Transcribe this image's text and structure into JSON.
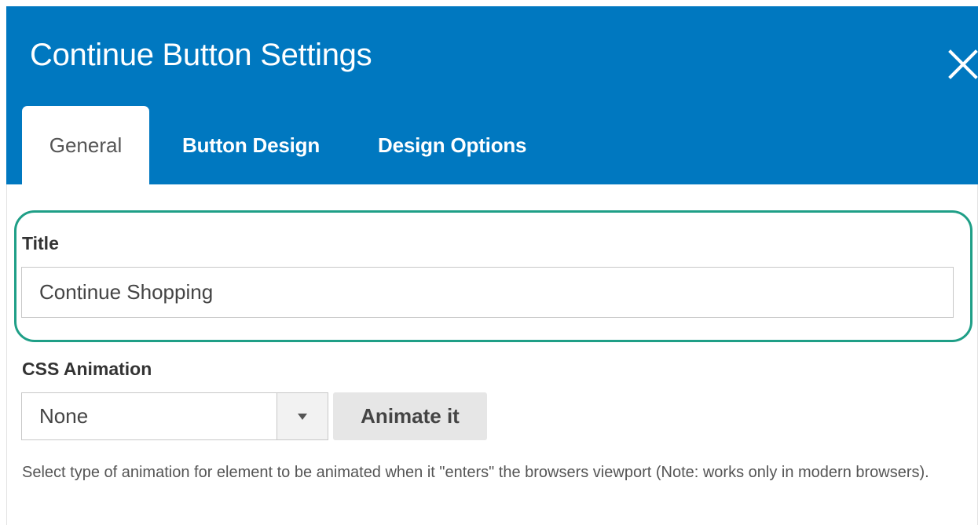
{
  "modal": {
    "title": "Continue Button Settings",
    "close_icon": "close-icon",
    "header_color": "#0078c0"
  },
  "tabs": [
    {
      "label": "General",
      "active": true
    },
    {
      "label": "Button Design",
      "active": false
    },
    {
      "label": "Design Options",
      "active": false
    }
  ],
  "form": {
    "title_field": {
      "label": "Title",
      "value": "Continue Shopping"
    },
    "highlight_color": "#1f9f87",
    "css_animation": {
      "label": "CSS Animation",
      "selected": "None",
      "dropdown_icon": "chevron-down-icon",
      "animate_button_label": "Animate it",
      "help_text": "Select type of animation for element to be animated when it \"enters\" the browsers viewport (Note: works only in modern browsers)."
    }
  }
}
